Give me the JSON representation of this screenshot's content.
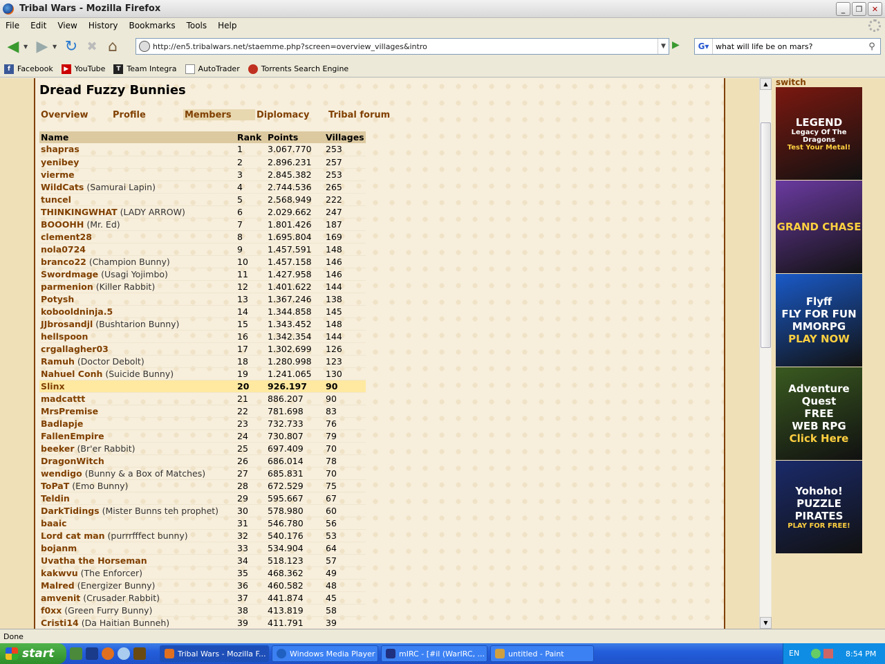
{
  "window": {
    "title": "Tribal Wars - Mozilla Firefox"
  },
  "menu": [
    "File",
    "Edit",
    "View",
    "History",
    "Bookmarks",
    "Tools",
    "Help"
  ],
  "nav": {
    "url": "http://en5.tribalwars.net/staemme.php?screen=overview_villages&intro",
    "search": "what will life be on mars?"
  },
  "bookmarks": [
    "Facebook",
    "YouTube",
    "Team Integra",
    "AutoTrader",
    "Torrents Search Engine"
  ],
  "page": {
    "tribe_name": "Dread Fuzzy Bunnies",
    "tabs": [
      "Overview",
      "Profile",
      "Members",
      "Diplomacy",
      "Tribal forum"
    ],
    "selected_tab": "Members",
    "columns": [
      "Name",
      "Rank",
      "Points",
      "Villages"
    ],
    "members": [
      {
        "name": "shapras",
        "title": "",
        "rank": "1",
        "points": "3.067.770",
        "villages": "253"
      },
      {
        "name": "yenibey",
        "title": "",
        "rank": "2",
        "points": "2.896.231",
        "villages": "257"
      },
      {
        "name": "vierme",
        "title": "",
        "rank": "3",
        "points": "2.845.382",
        "villages": "253"
      },
      {
        "name": "WildCats",
        "title": "(Samurai Lapin)",
        "rank": "4",
        "points": "2.744.536",
        "villages": "265"
      },
      {
        "name": "tuncel",
        "title": "",
        "rank": "5",
        "points": "2.568.949",
        "villages": "222"
      },
      {
        "name": "THINKINGWHAT",
        "title": "(LADY ARROW)",
        "rank": "6",
        "points": "2.029.662",
        "villages": "247"
      },
      {
        "name": "BOOOHH",
        "title": "(Mr. Ed)",
        "rank": "7",
        "points": "1.801.426",
        "villages": "187"
      },
      {
        "name": "clement28",
        "title": "",
        "rank": "8",
        "points": "1.695.804",
        "villages": "169"
      },
      {
        "name": "nola0724",
        "title": "",
        "rank": "9",
        "points": "1.457.591",
        "villages": "148"
      },
      {
        "name": "branco22",
        "title": "(Champion Bunny)",
        "rank": "10",
        "points": "1.457.158",
        "villages": "146"
      },
      {
        "name": "Swordmage",
        "title": "(Usagi Yojimbo)",
        "rank": "11",
        "points": "1.427.958",
        "villages": "146"
      },
      {
        "name": "parmenion",
        "title": "(Killer Rabbit)",
        "rank": "12",
        "points": "1.401.622",
        "villages": "144"
      },
      {
        "name": "Potysh",
        "title": "",
        "rank": "13",
        "points": "1.367.246",
        "villages": "138"
      },
      {
        "name": "kobooldninja.5",
        "title": "",
        "rank": "14",
        "points": "1.344.858",
        "villages": "145"
      },
      {
        "name": "JJbrosandjl",
        "title": "(Bushtarion Bunny)",
        "rank": "15",
        "points": "1.343.452",
        "villages": "148"
      },
      {
        "name": "hellspoon",
        "title": "",
        "rank": "16",
        "points": "1.342.354",
        "villages": "144"
      },
      {
        "name": "crgallagher03",
        "title": "",
        "rank": "17",
        "points": "1.302.699",
        "villages": "126"
      },
      {
        "name": "Ramuh",
        "title": "(Doctor Debolt)",
        "rank": "18",
        "points": "1.280.998",
        "villages": "123"
      },
      {
        "name": "Nahuel Conh",
        "title": "(Suicide Bunny)",
        "rank": "19",
        "points": "1.241.065",
        "villages": "130"
      },
      {
        "name": "Slinx",
        "title": "",
        "rank": "20",
        "points": "926.197",
        "villages": "90",
        "highlight": true
      },
      {
        "name": "madcattt",
        "title": "",
        "rank": "21",
        "points": "886.207",
        "villages": "90"
      },
      {
        "name": "MrsPremise",
        "title": "",
        "rank": "22",
        "points": "781.698",
        "villages": "83"
      },
      {
        "name": "Badlapje",
        "title": "",
        "rank": "23",
        "points": "732.733",
        "villages": "76"
      },
      {
        "name": "FallenEmpire",
        "title": "",
        "rank": "24",
        "points": "730.807",
        "villages": "79"
      },
      {
        "name": "beeker",
        "title": "(Br'er Rabbit)",
        "rank": "25",
        "points": "697.409",
        "villages": "70"
      },
      {
        "name": "DragonWitch",
        "title": "",
        "rank": "26",
        "points": "686.014",
        "villages": "78"
      },
      {
        "name": "wendigo",
        "title": "(Bunny & a Box of Matches)",
        "rank": "27",
        "points": "685.831",
        "villages": "70"
      },
      {
        "name": "ToPaT",
        "title": "(Emo Bunny)",
        "rank": "28",
        "points": "672.529",
        "villages": "75"
      },
      {
        "name": "Teldin",
        "title": "",
        "rank": "29",
        "points": "595.667",
        "villages": "67"
      },
      {
        "name": "DarkTidings",
        "title": "(Mister Bunns teh prophet)",
        "rank": "30",
        "points": "578.980",
        "villages": "60"
      },
      {
        "name": "baaic",
        "title": "",
        "rank": "31",
        "points": "546.780",
        "villages": "56"
      },
      {
        "name": "Lord cat man",
        "title": "(purrrfffect bunny)",
        "rank": "32",
        "points": "540.176",
        "villages": "53"
      },
      {
        "name": "bojanm",
        "title": "",
        "rank": "33",
        "points": "534.904",
        "villages": "64"
      },
      {
        "name": "Uvatha the Horseman",
        "title": "",
        "rank": "34",
        "points": "518.123",
        "villages": "57"
      },
      {
        "name": "kakwvu",
        "title": "(The Enforcer)",
        "rank": "35",
        "points": "468.362",
        "villages": "49"
      },
      {
        "name": "Malred",
        "title": "(Energizer Bunny)",
        "rank": "36",
        "points": "460.582",
        "villages": "48"
      },
      {
        "name": "amvenit",
        "title": "(Crusader Rabbit)",
        "rank": "37",
        "points": "441.874",
        "villages": "45"
      },
      {
        "name": "f0xx",
        "title": "(Green Furry Bunny)",
        "rank": "38",
        "points": "413.819",
        "villages": "58"
      },
      {
        "name": "Cristi14",
        "title": "(Da Haitian Bunneh)",
        "rank": "39",
        "points": "411.791",
        "villages": "39"
      }
    ]
  },
  "sidebar": {
    "switch": "switch",
    "ads": [
      {
        "name": "legend",
        "lines": [
          "LEGEND",
          "Legacy Of The Dragons",
          "Test Your Metal!"
        ],
        "bg": "#7a1810"
      },
      {
        "name": "grandchase",
        "lines": [
          "GRAND CHASE"
        ],
        "bg": "#6a3aa0"
      },
      {
        "name": "flyff",
        "lines": [
          "Flyff",
          "FLY FOR FUN",
          "MMORPG",
          "PLAY NOW"
        ],
        "bg": "#1a5ac8"
      },
      {
        "name": "adventurequest",
        "lines": [
          "Adventure",
          "Quest",
          "FREE",
          "WEB RPG",
          "Click Here"
        ],
        "bg": "#3a5a20"
      },
      {
        "name": "puzzlepirates",
        "lines": [
          "Yohoho!",
          "PUZZLE",
          "PIRATES",
          "PLAY FOR FREE!"
        ],
        "bg": "#1a2a6a"
      }
    ]
  },
  "status": "Done",
  "taskbar": {
    "start": "start",
    "tasks": [
      "Tribal Wars - Mozilla F...",
      "Windows Media Player",
      "mIRC - [#il (WarIRC, ...",
      "untitled - Paint"
    ],
    "lang": "EN",
    "clock": "8:54 PM"
  }
}
